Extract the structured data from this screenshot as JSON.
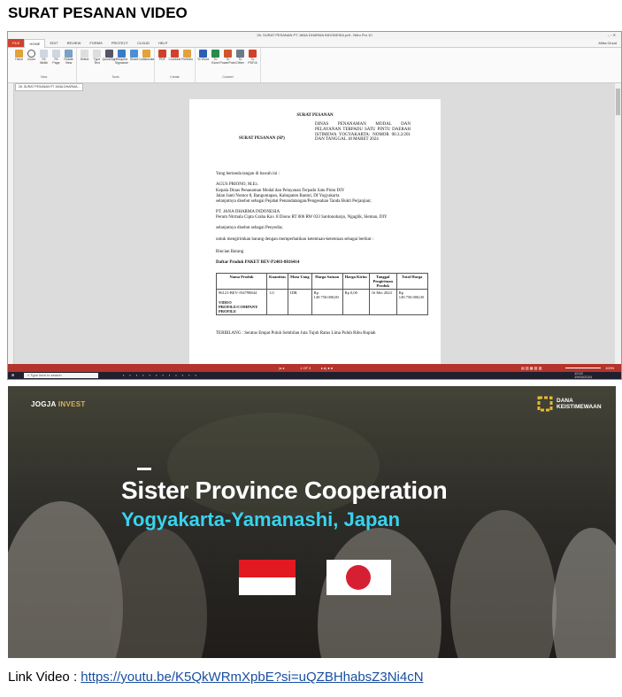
{
  "heading": "SURAT PESANAN VIDEO",
  "screenshot1": {
    "window_title": "26. SURAT PESANAN PT JANA DHARMA INDONESIA.pdf - Nitro Pro 10",
    "user": "Mitra Cloud",
    "ribbon_tabs": [
      "FILE",
      "HOME",
      "EDIT",
      "REVIEW",
      "FORMS",
      "PROTECT",
      "CLOUD",
      "HELP"
    ],
    "ribbon_groups": [
      {
        "label": "View",
        "buttons": [
          "Hand",
          "Zoom",
          "Fit Width",
          "Fit Page",
          "Rotate View"
        ]
      },
      {
        "label": "Tools",
        "buttons": [
          "Select",
          "Type Text",
          "QuickSign",
          "Request Signature",
          "Share",
          "Collaborate"
        ]
      },
      {
        "label": "Create",
        "buttons": [
          "PDF",
          "Combine",
          "Portfolio"
        ]
      },
      {
        "label": "Convert",
        "buttons": [
          "To Word",
          "To Excel",
          "To PowerPoint",
          "To Other",
          "To PDF/A"
        ]
      }
    ],
    "doc_tab": "26. SURAT PESANAN PT JANA DHARMA...",
    "page_status": "1 OF 3",
    "zoom": "100%",
    "taskbar_search": "Type here to search",
    "clock_time": "10:02",
    "clock_date": "19/04/2024",
    "document": {
      "title": "SURAT PESANAN",
      "sp_label": "SURAT PESANAN (SP)",
      "sp_value": "DINAS PENANAMAN MODAL DAN PELAYANAN TERPADU SATU PINTU DAERAH ISTIMEWA YOGYAKARTA: NOMOR 00.3.2/201 DAN TANGGAL 18 MARET 2024",
      "intro": "Yang bertanda tangan di bawah ini :",
      "signer_name": "AGUS PRIONO, M.Ec.",
      "signer_role": "Kepala Dinas Penanaman Modal dan Pelayanan Terpadu Satu Pintu DIY",
      "signer_address": "Jalan Janti Nomor 8, Banguntapan, Kabupaten Bantul, DI Yogyakarta",
      "signer_note": "selanjutnya disebut sebagai Pejabat Penandatangan/Pengesahan Tanda Bukti Perjanjian;",
      "vendor_name": "PT. JANA DHARMA INDONESIA",
      "vendor_address": "Perum Nirmala Cipta Graha Kav. 8 Diono RT 006 RW 033 Sardonoharjo, Ngaglik, Sleman, DIY",
      "vendor_note": "selanjutnya disebut sebagai Penyedia;",
      "order_note": "untuk mengirimkan barang dengan memperhatikan ketentuan-ketentuan sebagai berikut :",
      "rincian": "Rincian Barang",
      "list_title": "Daftar Produk PAKET BEV-P2403-8816414",
      "table_headers": [
        "Nama Produk",
        "Kuantitas",
        "Mata Uang",
        "Harga Satuan",
        "Harga Kirim",
        "Tanggal Pengiriman Produk",
        "Total Harga"
      ],
      "table_row": {
        "code": "96121-BEV-194798844",
        "name": "VIDEO PROFILE/COMPANY PROFILE",
        "qty": "1.0",
        "currency": "IDR",
        "unit_price": "Rp 149.750.000,00",
        "shipping": "Rp 0,00",
        "date": "16 Mei 2024",
        "total": "Rp 149.750.000,00"
      },
      "terbilang": "TERBILANG : Seratus Empat Puluh Sembilan Juta Tujuh Ratus Lima Puluh Ribu Rupiah"
    }
  },
  "screenshot2": {
    "logo_left_a": "JOGJA",
    "logo_left_b": "INVEST",
    "logo_right_a": "DANA",
    "logo_right_b": "KEISTIMEWAAN",
    "title_line1": "Sister Province Cooperation",
    "title_line2": "Yogyakarta-Yamanashi, Japan"
  },
  "link_label": "Link Video : ",
  "link_url": "https://youtu.be/K5QkWRmXpbE?si=uQZBHhabsZ3Ni4cN"
}
